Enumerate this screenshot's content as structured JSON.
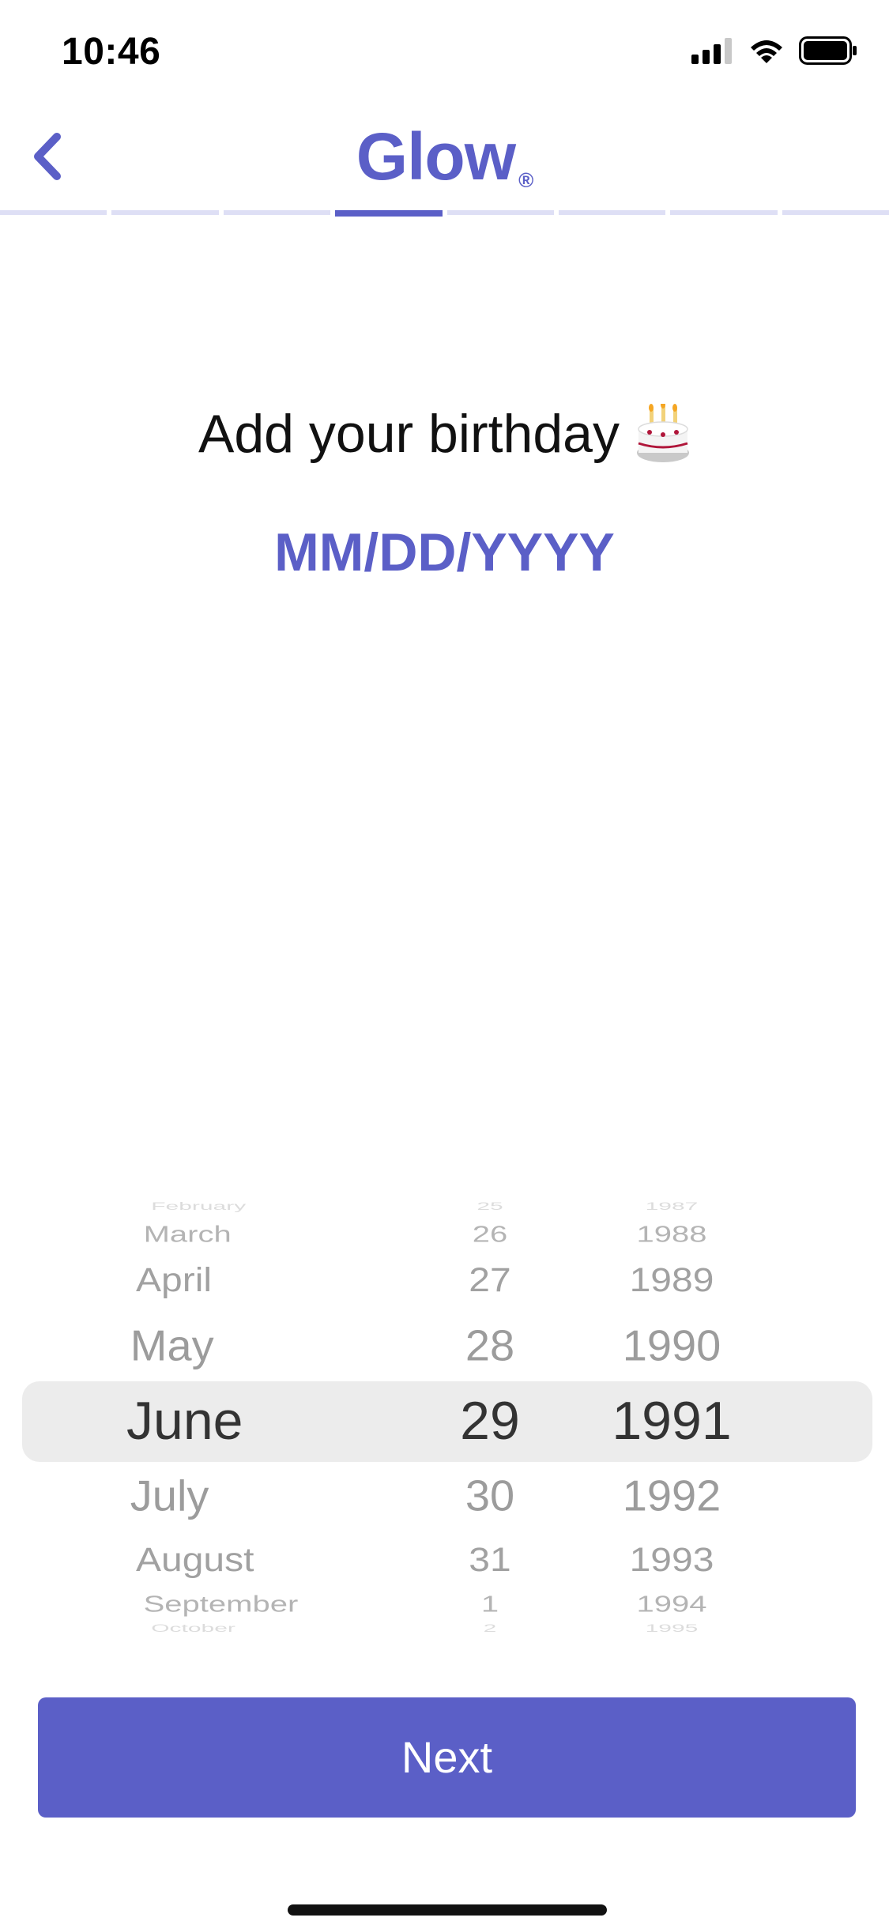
{
  "status_bar": {
    "time": "10:46",
    "icons": [
      "cellular-signal-icon",
      "wifi-icon",
      "battery-icon"
    ]
  },
  "header": {
    "brand": "Glow",
    "brand_mark": "®",
    "back_icon": "chevron-left-icon",
    "progress": {
      "total_steps": 8,
      "current_step": 4
    }
  },
  "main": {
    "title": "Add your birthday",
    "title_emoji": "birthday-cake-icon",
    "date_placeholder": "MM/DD/YYYY"
  },
  "picker": {
    "months": [
      "February",
      "March",
      "April",
      "May",
      "June",
      "July",
      "August",
      "September",
      "October"
    ],
    "days": [
      "25",
      "26",
      "27",
      "28",
      "29",
      "30",
      "31",
      "1",
      "2"
    ],
    "years": [
      "1987",
      "1988",
      "1989",
      "1990",
      "1991",
      "1992",
      "1993",
      "1994",
      "1995"
    ],
    "selected": {
      "month": "June",
      "day": "29",
      "year": "1991"
    }
  },
  "footer": {
    "next_label": "Next"
  },
  "colors": {
    "accent": "#5b5fc7",
    "progress_inactive": "#dedff5",
    "picker_band": "#ececec"
  }
}
